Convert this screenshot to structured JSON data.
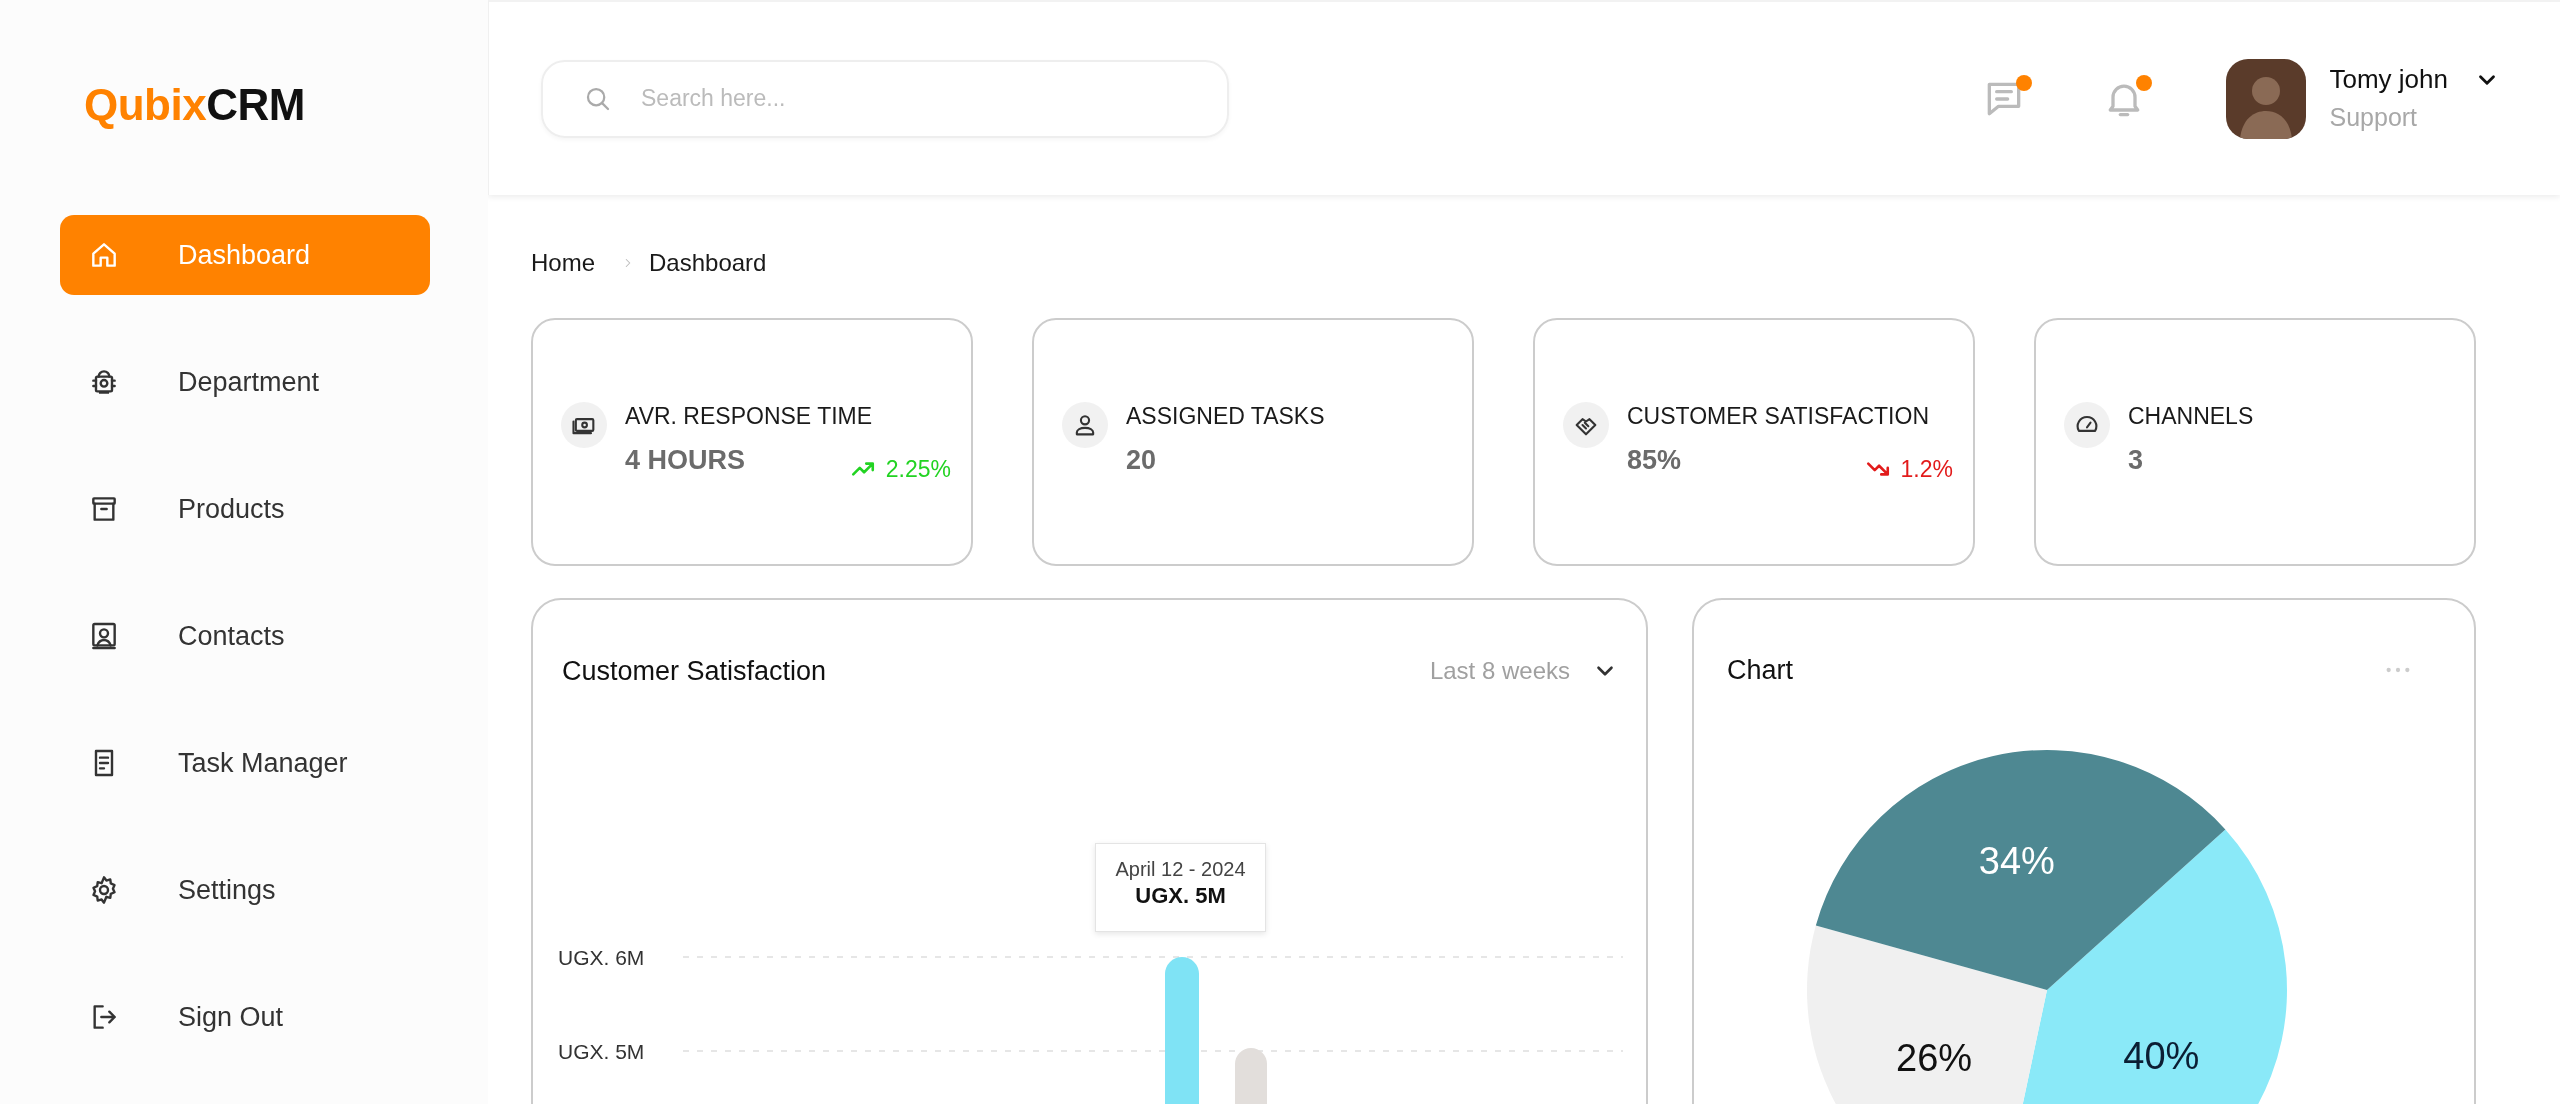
{
  "brand": {
    "accent": "Qubix",
    "rest": "CRM"
  },
  "sidebar": {
    "items": [
      {
        "label": "Dashboard",
        "selected": true
      },
      {
        "label": "Department",
        "selected": false
      },
      {
        "label": "Products",
        "selected": false
      },
      {
        "label": "Contacts",
        "selected": false
      },
      {
        "label": "Task Manager",
        "selected": false
      },
      {
        "label": "Settings",
        "selected": false
      },
      {
        "label": "Sign Out",
        "selected": false
      }
    ]
  },
  "header": {
    "search": {
      "placeholder": "Search here..."
    },
    "messages": {
      "badge": true
    },
    "notifications": {
      "badge": true
    },
    "user": {
      "name": "Tomy john",
      "role": "Support"
    }
  },
  "breadcrumb": [
    "Home",
    "Dashboard"
  ],
  "stats": [
    {
      "title": "AVR. RESPONSE TIME",
      "value": "4 HOURS",
      "trend": {
        "kind": "up",
        "value": "2.25%"
      }
    },
    {
      "title": "ASSIGNED TASKS",
      "value": "20"
    },
    {
      "title": "CUSTOMER SATISFACTION",
      "value": "85%",
      "trend": {
        "kind": "down",
        "value": "1.2%"
      }
    },
    {
      "title": "CHANNELS",
      "value": "3"
    }
  ],
  "satisfaction": {
    "title": "Customer Satisfaction",
    "period": "Last 8 weeks",
    "tooltip": {
      "date": "April 12 - 2024",
      "value": "UGX. 5M"
    },
    "y_axis_labels": [
      "UGX. 6M",
      "UGX. 5M"
    ]
  },
  "pie_card": {
    "title": "Chart",
    "chart_data": {
      "type": "pie",
      "values": [
        40,
        26,
        34
      ],
      "colors": [
        "#8ae9f8",
        "#f0f0f0",
        "#4e8892"
      ],
      "value_labels": [
        "40%",
        "26%",
        "34%"
      ]
    }
  }
}
